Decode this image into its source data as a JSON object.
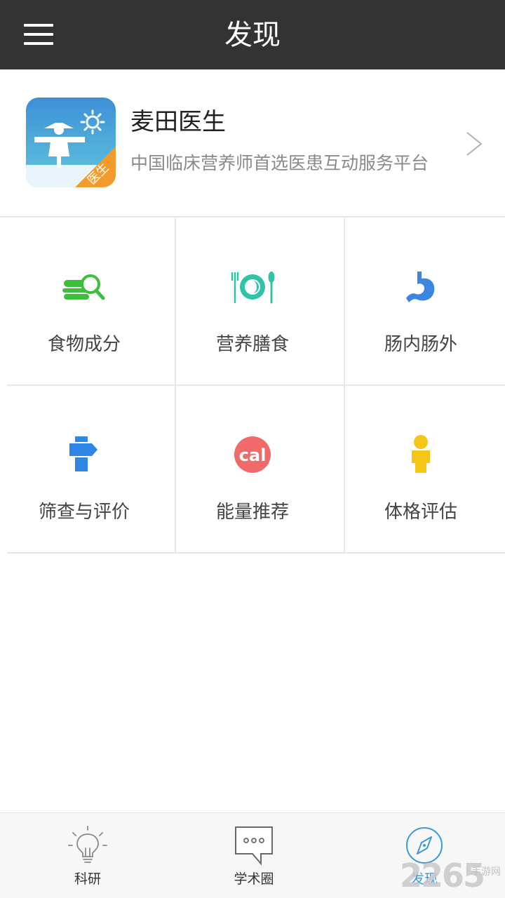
{
  "header": {
    "title": "发现",
    "menu_icon": "hamburger-icon"
  },
  "app_card": {
    "name": "麦田医生",
    "description": "中国临床营养师首选医患互动服务平台",
    "badge": "医生",
    "icon": "scarecrow-app-icon"
  },
  "grid": {
    "items": [
      {
        "label": "食物成分",
        "icon": "food-search-icon",
        "color": "#3dbf3d"
      },
      {
        "label": "营养膳食",
        "icon": "plate-cutlery-icon",
        "color": "#2fc4a8"
      },
      {
        "label": "肠内肠外",
        "icon": "stomach-icon",
        "color": "#3a86e0"
      },
      {
        "label": "筛查与评价",
        "icon": "signpost-icon",
        "color": "#2f86e6"
      },
      {
        "label": "能量推荐",
        "icon": "cal-icon",
        "color": "#f06a6a",
        "icon_text": "cal"
      },
      {
        "label": "体格评估",
        "icon": "person-icon",
        "color": "#f5c518"
      }
    ]
  },
  "bottom_nav": {
    "items": [
      {
        "label": "科研",
        "icon": "lightbulb-icon",
        "active": false
      },
      {
        "label": "学术圈",
        "icon": "chat-bubble-icon",
        "active": false
      },
      {
        "label": "发现",
        "icon": "compass-icon",
        "active": true
      }
    ]
  },
  "watermark": {
    "number": "2265",
    "text": "手游网"
  },
  "colors": {
    "header_bg": "#333333",
    "accent_blue": "#3a9ad9",
    "badge_orange": "#f39c2c"
  }
}
